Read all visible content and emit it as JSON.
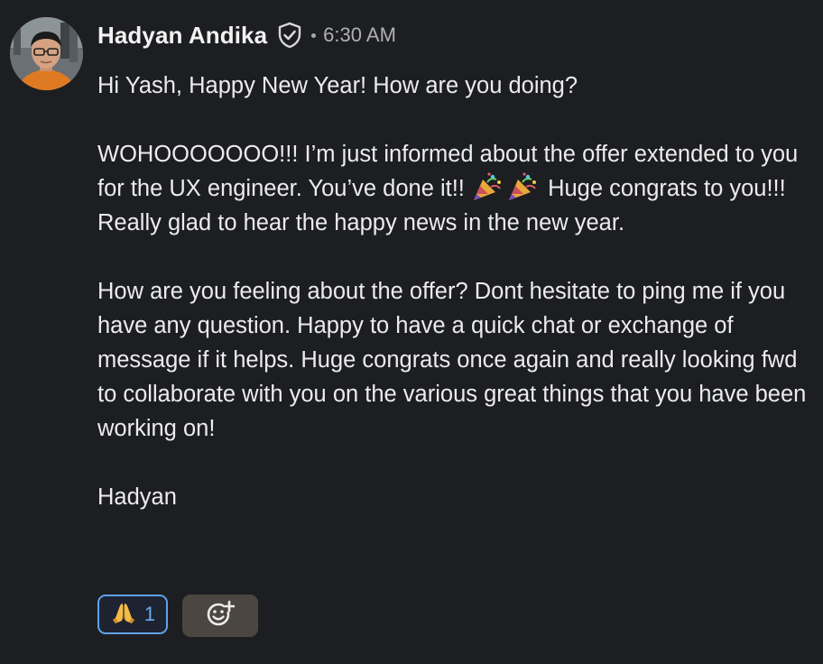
{
  "message": {
    "author": "Hadyan Andika",
    "verified_icon": "shield-check-icon",
    "timestamp": "6:30 AM",
    "paragraphs": [
      "Hi Yash, Happy New Year! How are you doing?",
      "WOHOOOOOOO!!! I’m just informed about the offer extended to you for the UX engineer. You’ve done it!!",
      "Huge congrats to you!!! Really glad to hear the happy news in the new year.",
      "How are you feeling about the offer? Dont hesitate to ping me if you have any question. Happy to have a quick chat or exchange of message if it helps. Huge congrats once again and really looking fwd to collaborate with you on the various great things that you have been working on!",
      "Hadyan"
    ],
    "inline_emoji": "party-popper-icon"
  },
  "reactions": {
    "items": [
      {
        "emoji": "folded-hands-icon",
        "count": "1"
      }
    ],
    "add_icon": "add-reaction-smiley-icon"
  },
  "colors": {
    "background": "#1d1e21",
    "text": "#ececec",
    "accent": "#5ea2ea",
    "add_button": "#4b4740"
  }
}
